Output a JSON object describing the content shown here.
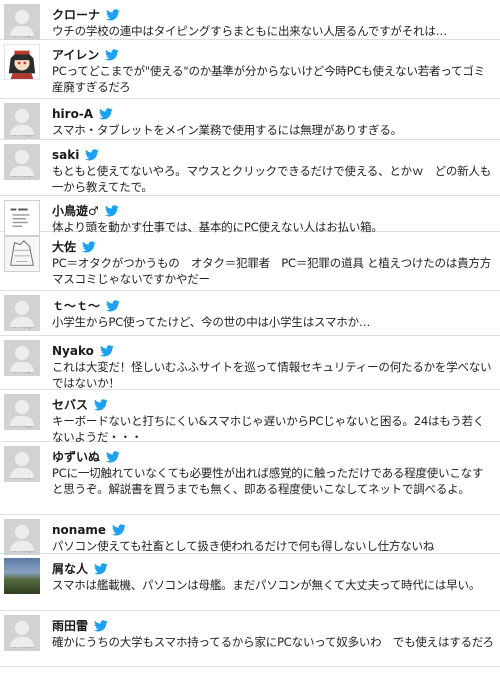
{
  "colors": {
    "accent": "#1da1f2",
    "avatar_placeholder": "#d2d2d2",
    "divider": "#dedede"
  },
  "icons": {
    "verified_badge": "twitter-bird-icon",
    "placeholder": "no-image-avatar"
  },
  "no_image_label": "no image",
  "tweets": [
    {
      "name": "クローナ",
      "avatar": "no-image",
      "text": "ウチの学校の連中はタイピングすらまともに出来ない人居るんですがそれは…"
    },
    {
      "name": "アイレン",
      "avatar": "anime-character",
      "text": "PCってどこまでが\"使える\"のか基準が分からないけど今時PCも使えない若者ってゴミ産廃すぎるだろ"
    },
    {
      "name": "hiro-A",
      "avatar": "no-image",
      "text": "スマホ・タブレットをメイン業務で使用するには無理がありすぎる。"
    },
    {
      "name": "saki",
      "avatar": "no-image",
      "text": "もともと使えてないやろ。マウスとクリックできるだけで使える、とかｗ　どの新人も一から教えてたで。"
    },
    {
      "name": "小鳥遊♂",
      "avatar": "document",
      "text": "体より頭を動かす仕事では、基本的にPC使えない人はお払い箱。"
    },
    {
      "name": "大佐",
      "avatar": "sketch",
      "text": "PC＝オタクがつかうもの　オタク＝犯罪者　PC＝犯罪の道具 と植えつけたのは貴方方マスコミじゃないですかやだー"
    },
    {
      "name": "ｔ～ｔ～",
      "avatar": "no-image",
      "text": "小学生からPC使ってたけど、今の世の中は小学生はスマホか…"
    },
    {
      "name": "Nyako",
      "avatar": "no-image",
      "text": "これは大変だ！怪しいむふふサイトを巡って情報セキュリティーの何たるかを学べないではないか！"
    },
    {
      "name": "セバス",
      "avatar": "no-image",
      "text": "キーボードないと打ちにくい&スマホじゃ遅いからPCじゃないと困る。24はもう若くないようだ・・・"
    },
    {
      "name": "ゆずいぬ",
      "avatar": "no-image",
      "text": "PCに一切触れていなくても必要性が出れば感覚的に触っただけである程度使いこなすと思うぞ。解説書を買うまでも無く、即ある程度使いこなしてネットで調べるよ。"
    },
    {
      "name": "noname",
      "avatar": "no-image",
      "text": "パソコン使えても社畜として扱き使われるだけで何も得しないし仕方ないね"
    },
    {
      "name": "屑な人",
      "avatar": "scenery",
      "text": "スマホは艦載機、パソコンは母艦。まだパソコンが無くて大丈夫って時代には早い。"
    },
    {
      "name": "雨田雷",
      "avatar": "no-image",
      "text": "確かにうちの大学もスマホ持ってるから家にPCないって奴多いわ　でも使えはするだろ"
    }
  ]
}
